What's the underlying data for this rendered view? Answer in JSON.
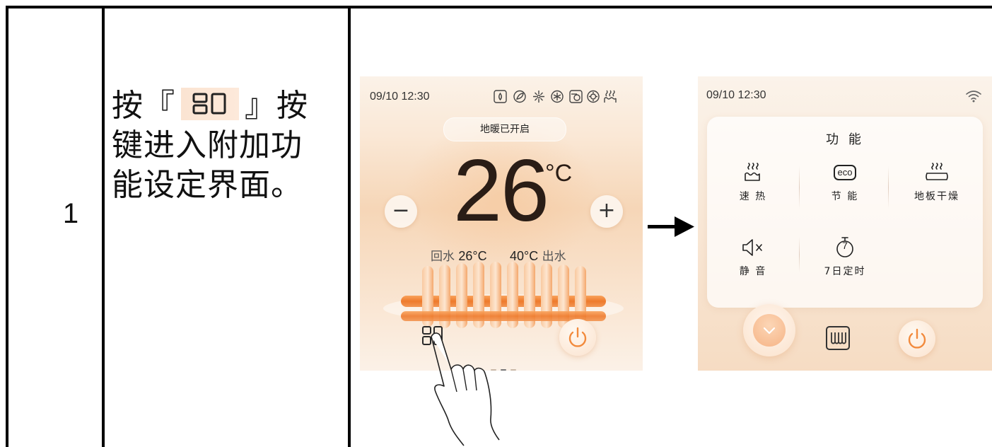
{
  "table": {
    "step_number": "1",
    "instruction": {
      "part1": "按『",
      "part2": "』按",
      "line2": "键进入附加功",
      "line3": "能设定界面。"
    }
  },
  "screen_main": {
    "datetime": "09/10  12:30",
    "status_pill": "地暖已开启",
    "temperature": "26",
    "unit": "°C",
    "minus": "−",
    "plus": "+",
    "return_label": "回水",
    "return_temp": "26°C",
    "supply_temp": "40°C",
    "supply_label": "出水",
    "status_icons": [
      "water-drop-icon",
      "leaf-icon",
      "fan-icon",
      "snowflake-icon",
      "schedule-icon",
      "sun-gear-icon",
      "heat-waves-icon"
    ]
  },
  "screen_function": {
    "datetime": "09/10  12:30",
    "panel_title": "功 能",
    "items": [
      {
        "label": "速 热",
        "icon": "fast-heat-icon"
      },
      {
        "label": "节 能",
        "icon": "eco-icon",
        "icon_text": "eco"
      },
      {
        "label": "地板干燥",
        "icon": "floor-dry-icon"
      },
      {
        "label": "静 音",
        "icon": "mute-icon"
      },
      {
        "label": "7日定时",
        "icon": "timer-7-icon",
        "icon_text": "7"
      }
    ]
  },
  "colors": {
    "accent_orange": "#f28a3c",
    "screen_bg": "#f8e4d0"
  }
}
